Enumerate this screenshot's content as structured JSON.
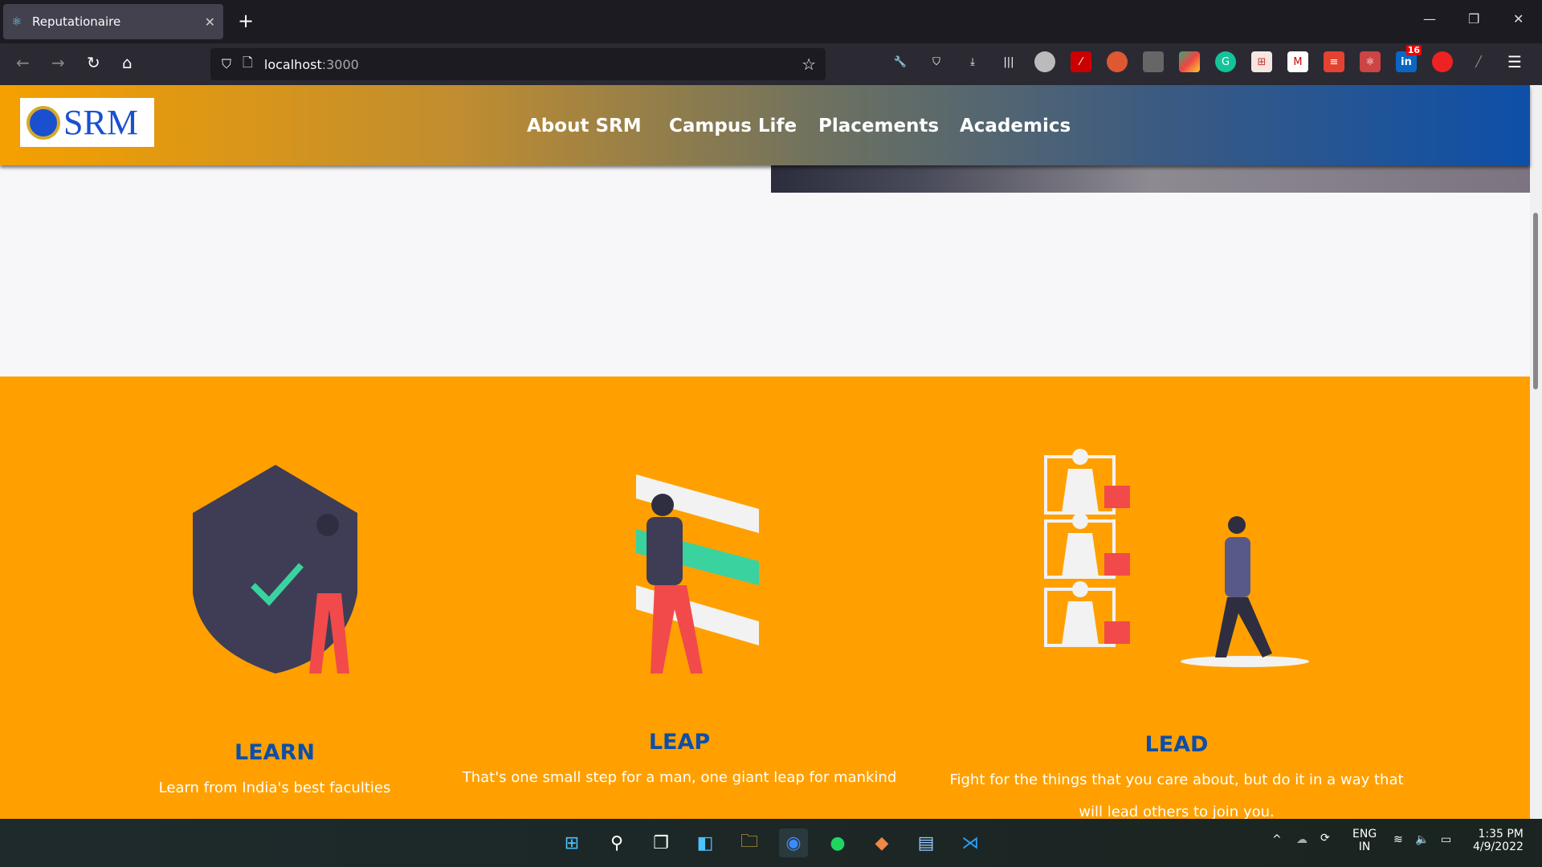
{
  "browser": {
    "tab_title": "Reputationaire",
    "new_tab": "+",
    "url_host": "localhost",
    "url_port": ":3000",
    "extensions": [
      "wrench",
      "pocket",
      "download",
      "library",
      "avatar",
      "magic-wand",
      "duckduckgo",
      "clipboard",
      "color-picker",
      "grammarly",
      "sitemap",
      "mcafee",
      "todoist",
      "react-devtools",
      "linkedin",
      "tomato",
      "ruler"
    ],
    "linkedin_badge": "16"
  },
  "header": {
    "logo_text": "SRM",
    "nav": [
      "About SRM",
      "Campus Life",
      "Placements",
      "Academics"
    ]
  },
  "columns": [
    {
      "title": "LEARN",
      "text": "Learn from India's best faculties"
    },
    {
      "title": "LEAP",
      "text": "That's one small step for a man, one giant leap for mankind"
    },
    {
      "title": "LEAD",
      "text": "Fight for the things that you care about, but do it in a way that will lead others to join you."
    }
  ],
  "colors": {
    "accent": "#ffa000",
    "title": "#0d4fa8"
  },
  "taskbar": {
    "lang": "ENG",
    "region": "IN",
    "time": "1:35 PM",
    "date": "4/9/2022"
  }
}
